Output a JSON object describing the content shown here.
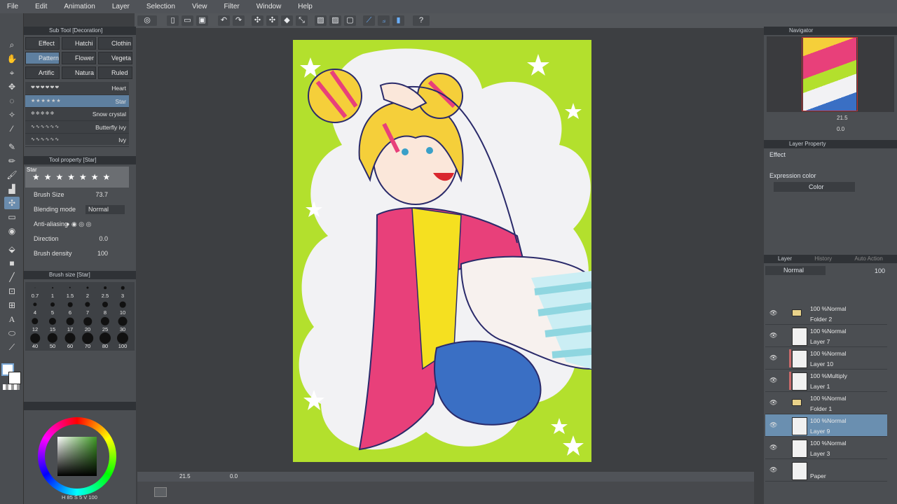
{
  "menu": [
    "File",
    "Edit",
    "Animation",
    "Layer",
    "Selection",
    "View",
    "Filter",
    "Window",
    "Help"
  ],
  "subtool": {
    "title": "Sub Tool [Decoration]",
    "tabs": [
      "Effect",
      "Hatchi",
      "Clothin",
      "Pattern",
      "Flower",
      "Vegeta",
      "Artific",
      "Natura",
      "Ruled"
    ],
    "selected_tab": "Pattern",
    "brushes": [
      "Heart",
      "Star",
      "Snow crystal",
      "Butterfly ivy",
      "Ivy"
    ],
    "selected_brush": "Star"
  },
  "toolprop": {
    "title": "Tool property [Star]",
    "brush_label": "Star",
    "brush_size_label": "Brush Size",
    "brush_size_value": "73.7",
    "blending_label": "Blending mode",
    "blending_value": "Normal",
    "aa_label": "Anti-aliasing",
    "direction_label": "Direction",
    "direction_value": "0.0",
    "density_label": "Brush density",
    "density_value": "100"
  },
  "brushsize": {
    "title": "Brush size [Star]",
    "values": [
      "0.7",
      "1",
      "1.5",
      "2",
      "2.5",
      "3",
      "4",
      "5",
      "6",
      "7",
      "8",
      "10",
      "12",
      "15",
      "17",
      "20",
      "25",
      "30",
      "40",
      "50",
      "60",
      "70",
      "80",
      "100"
    ]
  },
  "color": {
    "h": "85",
    "s": "5",
    "v": "100",
    "main": "#ffffff",
    "sub": "#ffffff"
  },
  "status": {
    "zoom": "21.5",
    "angle": "0.0"
  },
  "navigator": {
    "title": "Navigator",
    "zoom": "21.5",
    "angle": "0.0"
  },
  "layerprop": {
    "title": "Layer Property",
    "effect_label": "Effect",
    "expr_label": "Expression color",
    "expr_value": "Color"
  },
  "layerpanel": {
    "tabs": [
      "Layer",
      "History",
      "Auto Action"
    ],
    "blend": "Normal",
    "opacity": "100",
    "layers": [
      {
        "mode": "100 %Normal",
        "name": "Folder 2",
        "type": "folder"
      },
      {
        "mode": "100 %Normal",
        "name": "Layer 7",
        "type": "raster"
      },
      {
        "mode": "100 %Normal",
        "name": "Layer 10",
        "type": "raster",
        "clip": true
      },
      {
        "mode": "100 %Multiply",
        "name": "Layer 1",
        "type": "raster",
        "clip": true
      },
      {
        "mode": "100 %Normal",
        "name": "Folder 1",
        "type": "folder"
      },
      {
        "mode": "100 %Normal",
        "name": "Layer 9",
        "type": "raster",
        "selected": true
      },
      {
        "mode": "100 %Normal",
        "name": "Layer 3",
        "type": "raster"
      },
      {
        "mode": "",
        "name": "Paper",
        "type": "paper"
      }
    ]
  },
  "colors": {
    "canvas_bg": "#b3e02d",
    "cloud": "#f2f2f4",
    "jacket": "#e8407a",
    "hair": "#f5cf3a",
    "shorts": "#3a6fc4",
    "stripe": "#8fd6e0"
  }
}
